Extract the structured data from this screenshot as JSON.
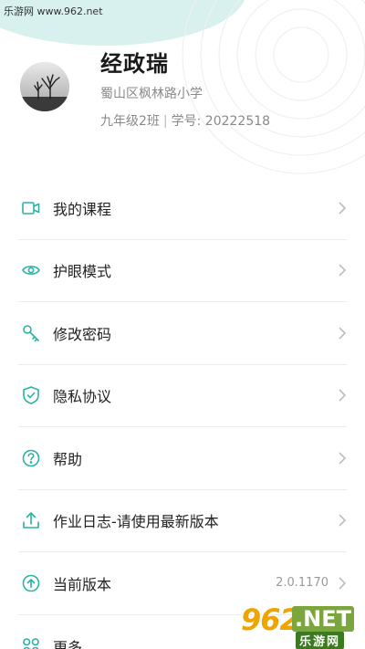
{
  "watermark": {
    "top_left": "乐游网 www.962.net",
    "bottom_right_number": "962",
    "bottom_right_tld": ".NET",
    "bottom_right_sub": "乐游网"
  },
  "profile": {
    "name": "经政瑞",
    "school": "蜀山区枫林路小学",
    "class": "九年级2班",
    "separator": "|",
    "student_no": "学号: 20222518"
  },
  "menu": {
    "items": [
      {
        "label": "我的课程",
        "icon": "video-icon",
        "value": ""
      },
      {
        "label": "护眼模式",
        "icon": "eye-icon",
        "value": ""
      },
      {
        "label": "修改密码",
        "icon": "key-icon",
        "value": ""
      },
      {
        "label": "隐私协议",
        "icon": "shield-check-icon",
        "value": ""
      },
      {
        "label": "帮助",
        "icon": "help-icon",
        "value": ""
      },
      {
        "label": "作业日志-请使用最新版本",
        "icon": "upload-icon",
        "value": ""
      },
      {
        "label": "当前版本",
        "icon": "arrow-up-circle-icon",
        "value": "2.0.1170"
      },
      {
        "label": "更多",
        "icon": "grid-icon",
        "value": ""
      }
    ]
  },
  "colors": {
    "accent": "#2bb3a3",
    "text": "#222222",
    "subtext": "#8a8a8a",
    "divider": "#ececec",
    "header_blob": "#d8f1ee"
  }
}
